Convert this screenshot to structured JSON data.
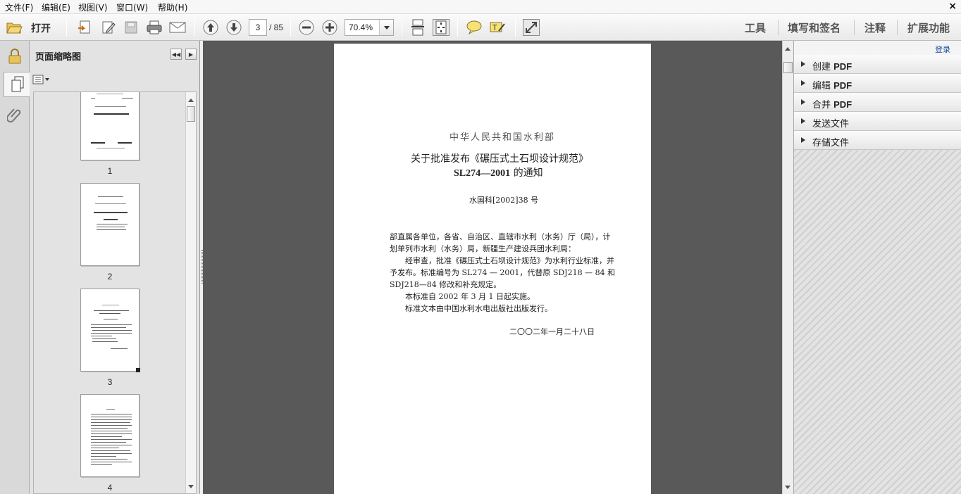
{
  "menu": {
    "file": "文件(F)",
    "edit": "编辑(E)",
    "view": "视图(V)",
    "window": "窗口(W)",
    "help": "帮助(H)",
    "close": "×"
  },
  "toolbar": {
    "open_label": "打开",
    "current_page": "3",
    "page_total": "/ 85",
    "zoom": "70.4%",
    "tools": "工具",
    "fill_sign": "填写和签名",
    "comment": "注释",
    "extended": "扩展功能"
  },
  "thumb_panel": {
    "title": "页面缩略图",
    "pages": [
      "1",
      "2",
      "3",
      "4"
    ],
    "selected_page": "3"
  },
  "document": {
    "ministry": "中华人民共和国水利部",
    "title_line1": "关于批准发布《碾压式土石坝设计规范》",
    "title_line2_code": "SL274—2001",
    "title_line2_rest": " 的通知",
    "doc_number": "水国科[2002]38 号",
    "para1_line1": "部直属各单位，各省、自治区、直辖市水利（水务）厅（局），计",
    "para1_line2": "划单列市水利（水务）局，新疆生产建设兵团水利局：",
    "para2_line1": "经审查，批准《碾压式土石坝设计规范》为水利行业标准，并",
    "para2_line2": "予发布。标准编号为 SL274 — 2001，代替原 SDJ218 — 84 和",
    "para2_line3": "SDJ218—84 修改和补充规定。",
    "para3": "本标准自 2002 年 3 月 1 日起实施。",
    "para4": "标准文本由中国水利水电出版社出版发行。",
    "date": "二〇〇二年一月二十八日"
  },
  "right_panel": {
    "login": "登录",
    "items": [
      {
        "prefix": "创建 ",
        "bold": "PDF"
      },
      {
        "prefix": "编辑 ",
        "bold": "PDF"
      },
      {
        "prefix": "合并 ",
        "bold": "PDF"
      },
      {
        "prefix": "发送文件",
        "bold": ""
      },
      {
        "prefix": "存储文件",
        "bold": ""
      }
    ]
  },
  "colors": {
    "doc_background": "#595959",
    "link_blue": "#1b4f9c"
  }
}
